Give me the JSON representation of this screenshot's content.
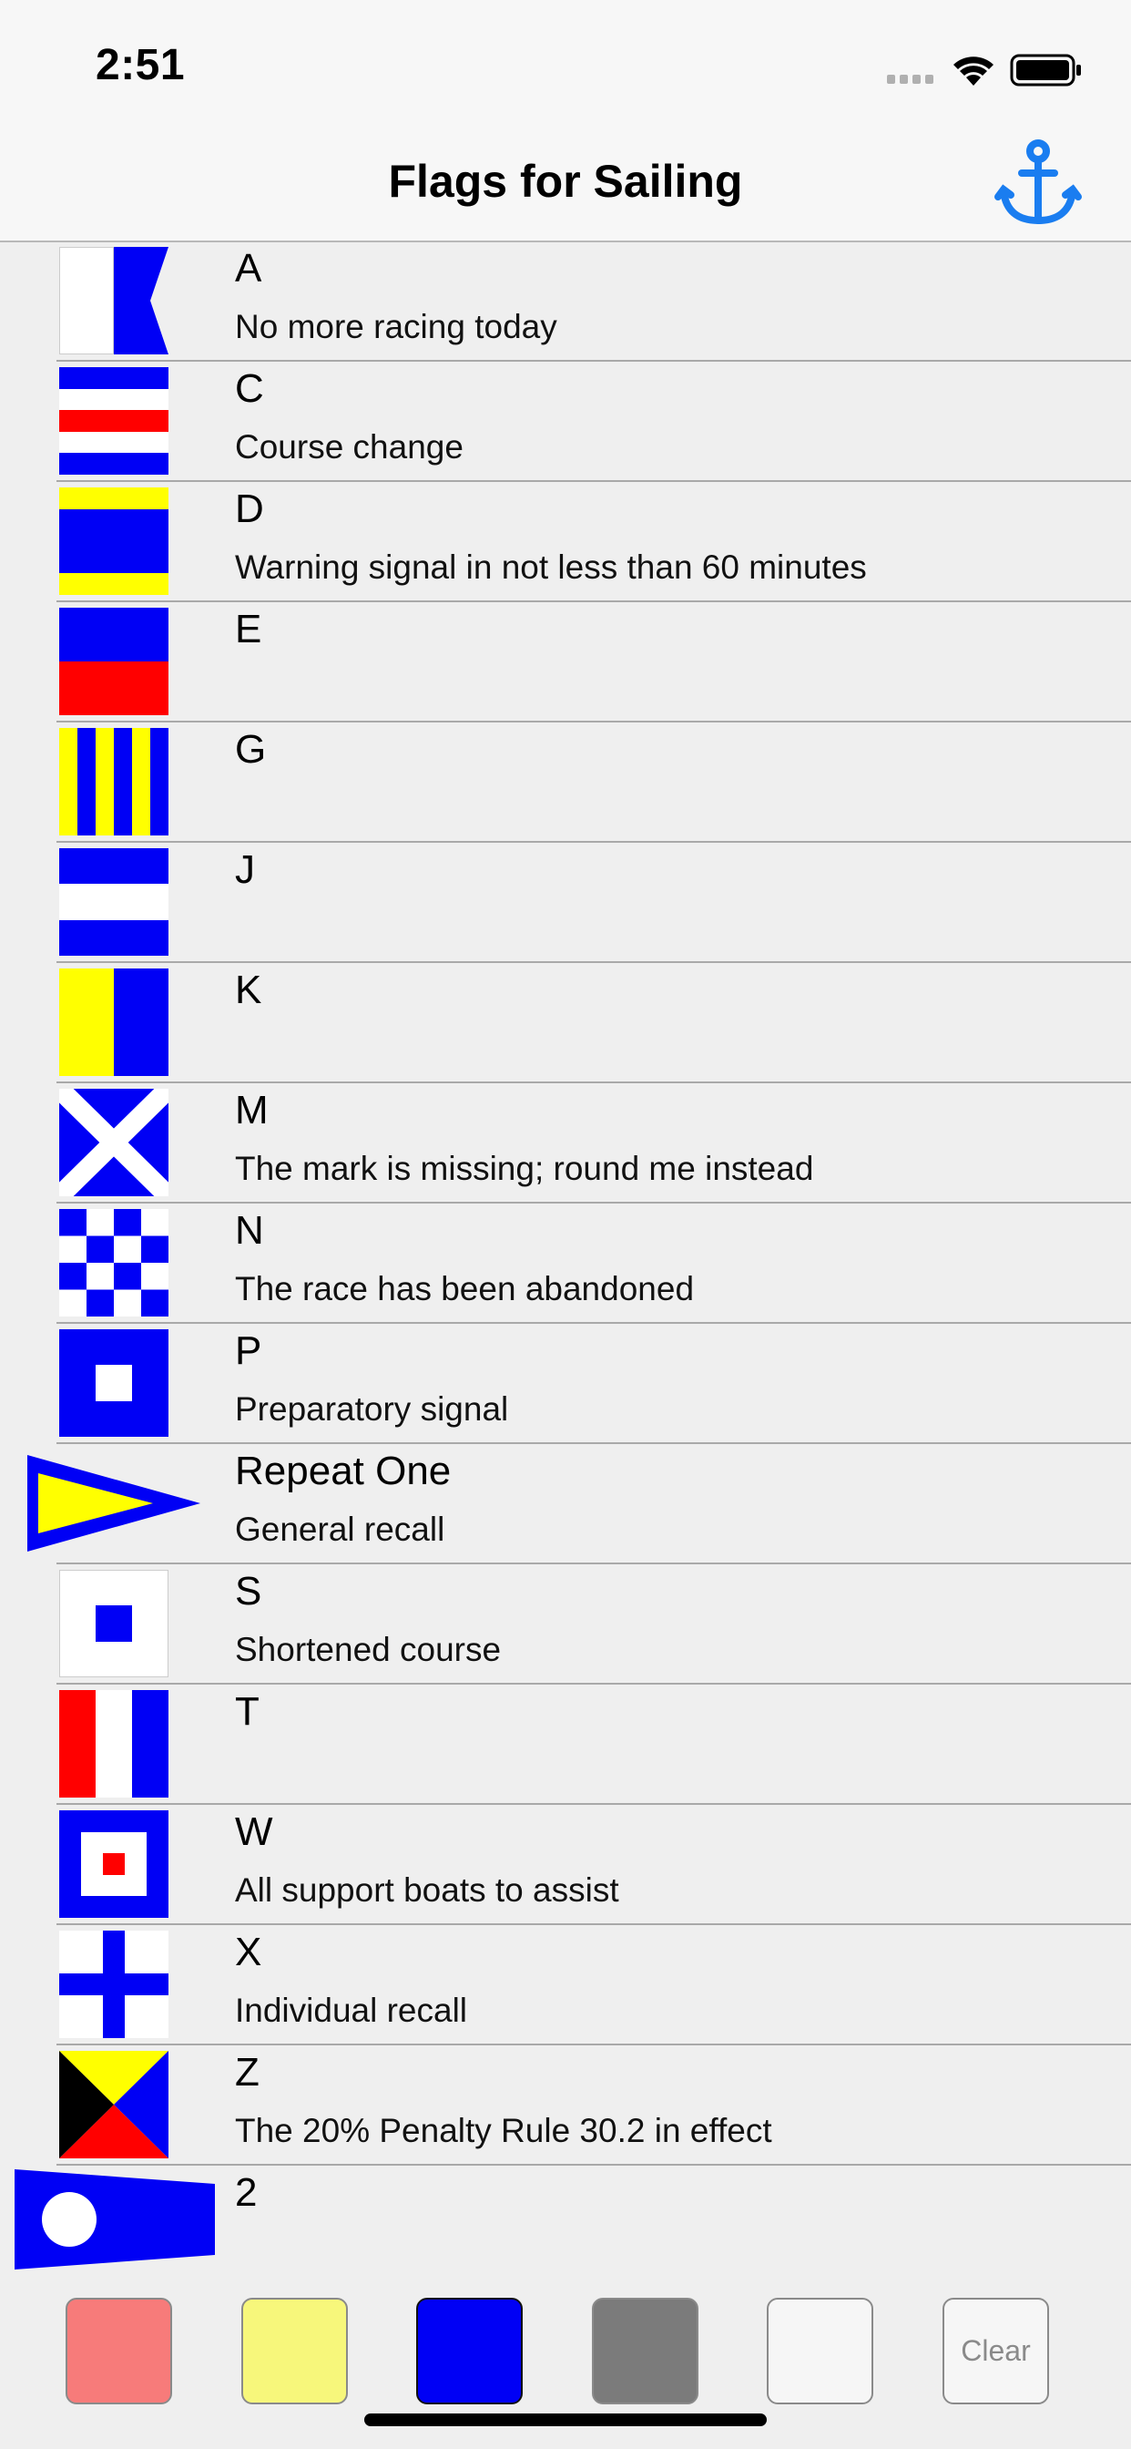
{
  "status_bar": {
    "time": "2:51"
  },
  "nav": {
    "title": "Flags for Sailing",
    "right_icon": "anchor-icon",
    "accent_color": "#1a7df0"
  },
  "flags": [
    {
      "letter": "A",
      "description": "No more racing today",
      "icon": "flag-alpha-icon"
    },
    {
      "letter": "C",
      "description": "Course change",
      "icon": "flag-charlie-icon"
    },
    {
      "letter": "D",
      "description": "Warning signal in not less than 60 minutes",
      "icon": "flag-delta-icon"
    },
    {
      "letter": "E",
      "description": "",
      "icon": "flag-echo-icon"
    },
    {
      "letter": "G",
      "description": "",
      "icon": "flag-golf-icon"
    },
    {
      "letter": "J",
      "description": "",
      "icon": "flag-juliet-icon"
    },
    {
      "letter": "K",
      "description": "",
      "icon": "flag-kilo-icon"
    },
    {
      "letter": "M",
      "description": "The mark is missing; round me instead",
      "icon": "flag-mike-icon"
    },
    {
      "letter": "N",
      "description": "The race has been abandoned",
      "icon": "flag-november-icon"
    },
    {
      "letter": "P",
      "description": "Preparatory signal",
      "icon": "flag-papa-icon"
    },
    {
      "letter": "Repeat One",
      "description": "General recall",
      "icon": "pennant-repeat-one-icon"
    },
    {
      "letter": "S",
      "description": "Shortened course",
      "icon": "flag-sierra-icon"
    },
    {
      "letter": "T",
      "description": "",
      "icon": "flag-tango-icon"
    },
    {
      "letter": "W",
      "description": "All support boats to assist",
      "icon": "flag-whiskey-icon"
    },
    {
      "letter": "X",
      "description": "Individual recall",
      "icon": "flag-xray-icon"
    },
    {
      "letter": "Z",
      "description": "The 20% Penalty Rule 30.2 in effect",
      "icon": "flag-zulu-icon"
    },
    {
      "letter": "2",
      "description": "",
      "icon": "pennant-two-icon"
    }
  ],
  "color_palette": {
    "swatches": [
      {
        "color": "#f77b7a",
        "label": "red"
      },
      {
        "color": "#f7f77b",
        "label": "yellow"
      },
      {
        "color": "#0000f5",
        "label": "blue"
      },
      {
        "color": "#7b7b7b",
        "label": "gray"
      },
      {
        "color": "#f6f6f6",
        "label": "white"
      }
    ],
    "clear_label": "Clear"
  }
}
